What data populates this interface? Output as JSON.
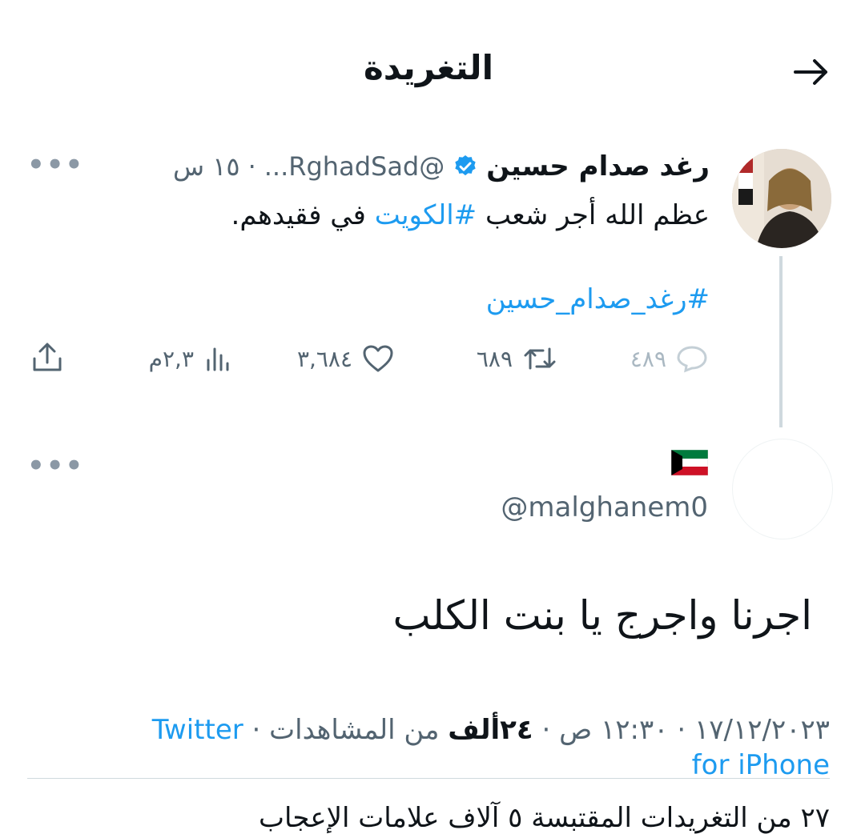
{
  "header": {
    "title": "التغريدة"
  },
  "tweet": {
    "name": "رغد صدام حسين",
    "handle": "...RghadSad@",
    "separator": "·",
    "time": "١٥ س",
    "text_pre": "عظم الله أجر شعب ",
    "hashtag_kuwait": "#الكويت",
    "text_post": " في فقيدهم.",
    "hashtag_line": "#رغد_صدام_حسين",
    "stats": {
      "replies": "٤٨٩",
      "retweets": "٦٨٩",
      "likes": "٣,٦٨٤",
      "views": "٢,٣م"
    }
  },
  "reply": {
    "flag": "🇰🇼",
    "handle": "@malghanem0",
    "text": "اجرنا واجرج يا بنت الكلب"
  },
  "meta": {
    "date_time": "١٧/١٢/٢٠٢٣ · ١٢:٣٠ ص · ",
    "views_count": "٢٤ألف",
    "views_label": " من المشاهدات · ",
    "source_line1": "Twitter",
    "source_line2": "for iPhone"
  },
  "below_cut": {
    "text": "٢٧ من التغريدات المقتبسة  ٥ آلاف علامات الإعجاب"
  },
  "colors": {
    "accent": "#1d9bf0",
    "muted": "#536471",
    "border": "#cfd9de"
  }
}
